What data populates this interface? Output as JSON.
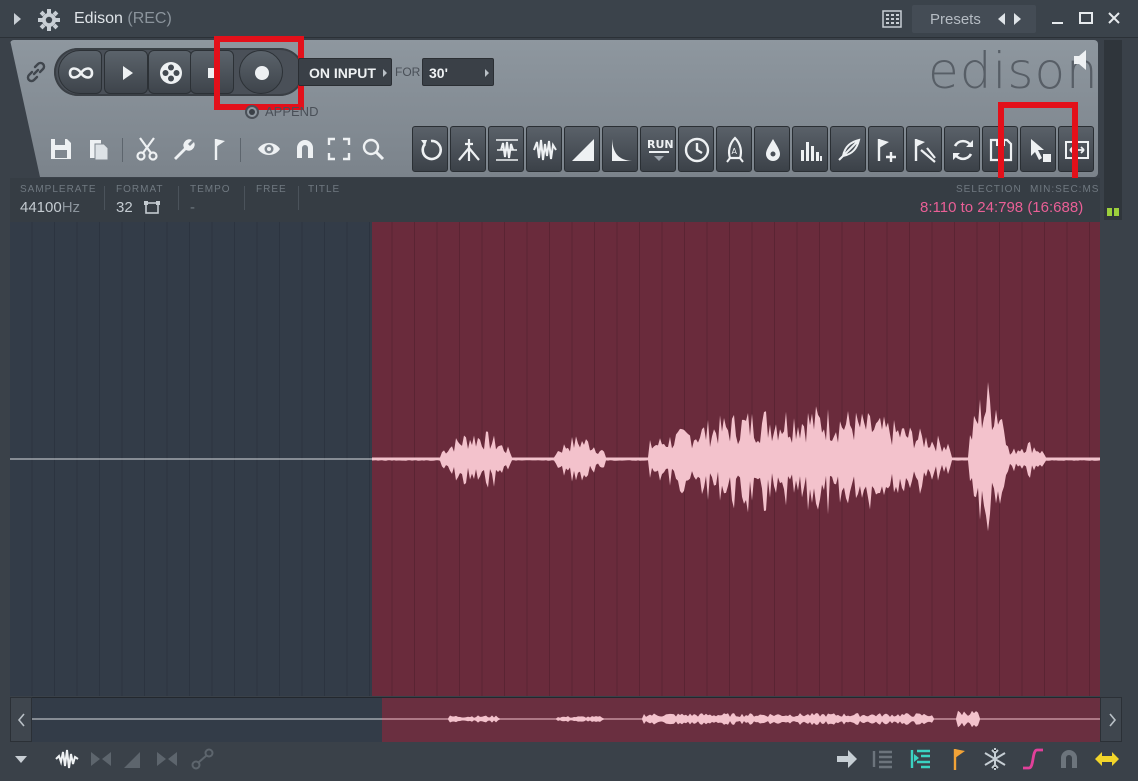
{
  "window": {
    "title": "Edison",
    "title_suffix": "(REC)",
    "presets_label": "Presets"
  },
  "toolbar": {
    "record_mode": "ON INPUT",
    "for_label": "FOR",
    "for_value": "30'",
    "append_label": "APPEND",
    "logo": "edison"
  },
  "info": {
    "samplerate_label": "SAMPLERATE",
    "samplerate_value": "44100",
    "samplerate_unit": "Hz",
    "format_label": "FORMAT",
    "format_value": "32",
    "tempo_label": "TEMPO",
    "tempo_value": "-",
    "free_label": "FREE",
    "title_label": "TITLE",
    "selection_label": "SELECTION",
    "minsec_label": "MIN:SEC:MS",
    "selection_value": "8:110 to 24:798 (16:688)"
  },
  "tools": [
    "undo",
    "declick",
    "normalize",
    "trim",
    "fade-in",
    "fade-out",
    "run",
    "time-stretch",
    "amplify",
    "denoise",
    "equalize",
    "blur",
    "add-marker",
    "slice",
    "convert",
    "save-region",
    "select",
    "fit"
  ],
  "colors": {
    "selection": "#6a2b3c",
    "waveform": "#f3c2cc",
    "highlight": "#e3101a",
    "selection_text": "#ea5f96"
  }
}
